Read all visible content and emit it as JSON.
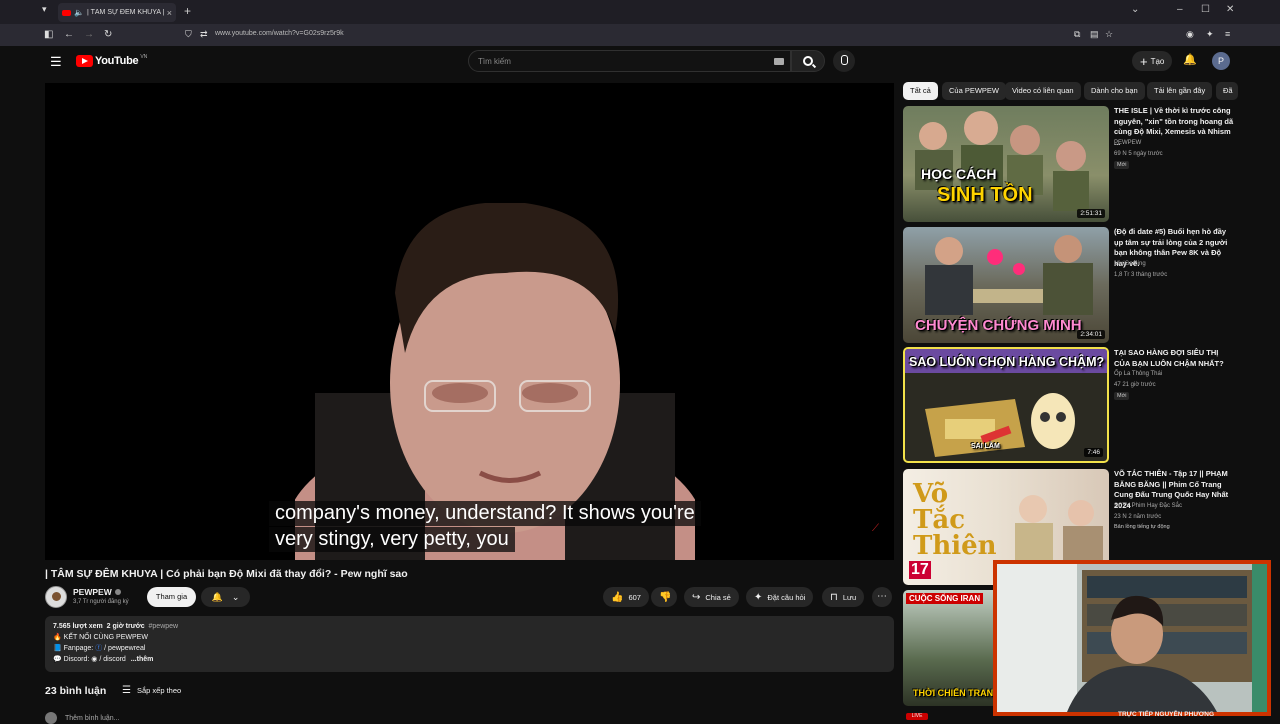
{
  "browser": {
    "tab_title": "| TÂM SỰ ĐÊM KHUYA | Có",
    "url": "www.youtube.com/watch?v=G02s9rz5r9k"
  },
  "header": {
    "logo": "YouTube",
    "region": "VN",
    "search_placeholder": "Tìm kiếm",
    "create_label": "Tạo",
    "avatar_letter": "P"
  },
  "player": {
    "caption_line1": "company's money, understand? It shows you're",
    "caption_line2": "very stingy, very petty, you"
  },
  "video": {
    "title": "| TÂM SỰ ĐÊM KHUYA | Có phải bạn Độ Mixi đã thay đổi? - Pew nghĩ sao",
    "channel": "PEWPEW",
    "subscribers": "3,7 Tr người đăng ký",
    "join_label": "Tham gia",
    "likes": "607",
    "share_label": "Chia sẻ",
    "ask_label": "Đặt câu hỏi",
    "save_label": "Lưu"
  },
  "description": {
    "views": "7.565 lượt xem",
    "time": "2 giờ trước",
    "hashtag": "#pewpew",
    "line1": "🔥 KẾT NỐI CÙNG PEWPEW",
    "line2_prefix": "📘 Fanpage:",
    "line2_link": "/ pewpewreal",
    "line3_prefix": "💬 Discord:",
    "line3_link": "/ discord",
    "more": "...thêm"
  },
  "comments": {
    "count": "23 bình luận",
    "sort_label": "Sắp xếp theo",
    "add_placeholder": "Thêm bình luận..."
  },
  "chips": [
    "Tất cả",
    "Của PEWPEW",
    "Video có liên quan",
    "Dành cho bạn",
    "Tải lên gần đây",
    "Đã"
  ],
  "recommendations": [
    {
      "title": "THE ISLE | Về thời kì trước công nguyên, \"xin\" tồn trong hoang dã cùng Độ Mixi, Xemesis và Nhism ...",
      "channel": "PEWPEW",
      "meta": "69 N  5 ngày trước",
      "badge": "Mới",
      "duration": "2:51:31",
      "thumb_text1": "HỌC CÁCH",
      "thumb_text2": "SINH TỒN"
    },
    {
      "title": "(Độ đi date #5) Buổi hẹn hò đầy ụp tâm sự trải lòng của 2 người bạn không thân Pew 8K và Độ hay vẽ.",
      "channel": "MixiGaming",
      "meta": "1,8 Tr  3 tháng trước",
      "duration": "2:34:01",
      "thumb_text1": "CHUYỆN CHỨNG MINH"
    },
    {
      "title": "TẠI SAO HÀNG ĐỢI SIÊU THỊ CỦA BẠN LUÔN CHẬM NHẤT?",
      "channel": "Ốp La Thông Thái",
      "meta": "47  21 giờ trước",
      "badge": "Mới",
      "duration": "7:46",
      "thumb_text1": "SAO LUÔN CHỌN HÀNG CHẬM?",
      "thumb_text2": "SAI LẦM"
    },
    {
      "title": "VÕ TẮC THIÊN - Tập 17 || PHẠM BĂNG BĂNG || Phim Cổ Trang Cung Đấu Trung Quốc Hay Nhất 2024",
      "channel": "SCTV Phim Hay Đặc Sắc",
      "meta": "23 N  2 năm trước",
      "badge": "Bản lồng tiếng tự động",
      "thumb_text1": "Võ Tắc Thiên",
      "thumb_text2": "17"
    },
    {
      "thumb_text1": "CUỘC SỐNG IRAN",
      "thumb_text2": "THỜI CHIẾN TRAN"
    }
  ],
  "webcam": {
    "label": "TRỰC TIẾP NGUYỄN PHƯƠNG",
    "live_badge": "LIVE"
  }
}
